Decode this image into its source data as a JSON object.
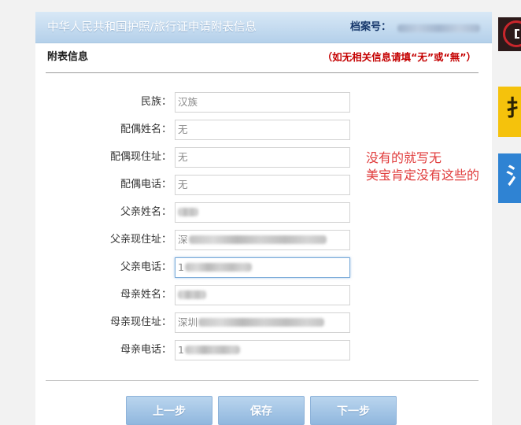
{
  "header": {
    "title": "中华人民共和国护照/旅行证申请附表信息",
    "archive_label": "档案号：",
    "archive_redacted": true
  },
  "section": {
    "title": "附表信息",
    "note": "（如无相关信息请填“无”或“無”）"
  },
  "fields": [
    {
      "label": "民族：",
      "value": "汉族"
    },
    {
      "label": "配偶姓名：",
      "value": "无"
    },
    {
      "label": "配偶现住址：",
      "value": "无"
    },
    {
      "label": "配偶电话：",
      "value": "无"
    },
    {
      "label": "父亲姓名：",
      "value": "",
      "redacted": true
    },
    {
      "label": "父亲现住址：",
      "value": "深",
      "redacted": true
    },
    {
      "label": "父亲电话：",
      "value": "1",
      "redacted": true,
      "focused": true
    },
    {
      "label": "母亲姓名：",
      "value": "",
      "redacted": true
    },
    {
      "label": "母亲现住址：",
      "value": "深圳",
      "redacted": true
    },
    {
      "label": "母亲电话：",
      "value": "1",
      "redacted": true
    }
  ],
  "annotation": {
    "line1": "没有的就写无",
    "line2": "美宝肯定没有这些的",
    "color": "#e03b3b"
  },
  "buttons": {
    "prev": "上一步",
    "save": "保存",
    "next": "下一步"
  },
  "sidebar": {
    "tiles": [
      {
        "glyph": "扌",
        "bg": "#f5c20c",
        "fg": "#2b2204"
      },
      {
        "glyph": "氵",
        "bg": "#2f83d3",
        "fg": "#ffffff"
      }
    ]
  },
  "colors": {
    "header_title": "#ffffff",
    "archive_label": "#17386c",
    "note": "#c40000",
    "button_text": "#ffffff"
  }
}
